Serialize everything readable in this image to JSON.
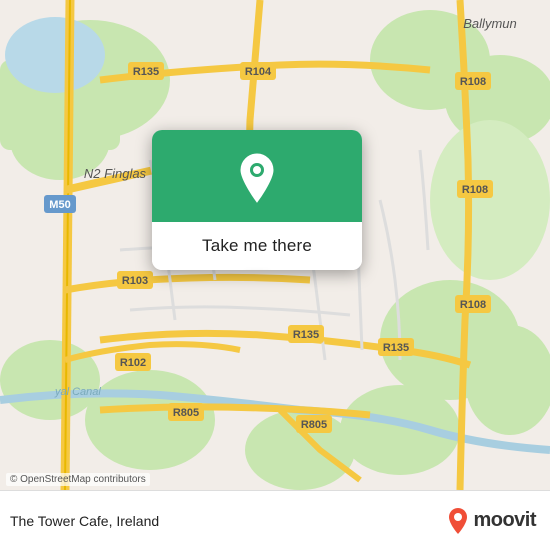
{
  "map": {
    "background_color": "#e8e0d8",
    "attribution": "© OpenStreetMap contributors"
  },
  "popup": {
    "button_label": "Take me there",
    "icon_bg_color": "#2daa6e"
  },
  "footer": {
    "place_name": "The Tower Cafe, Ireland",
    "moovit_label": "moovit"
  }
}
